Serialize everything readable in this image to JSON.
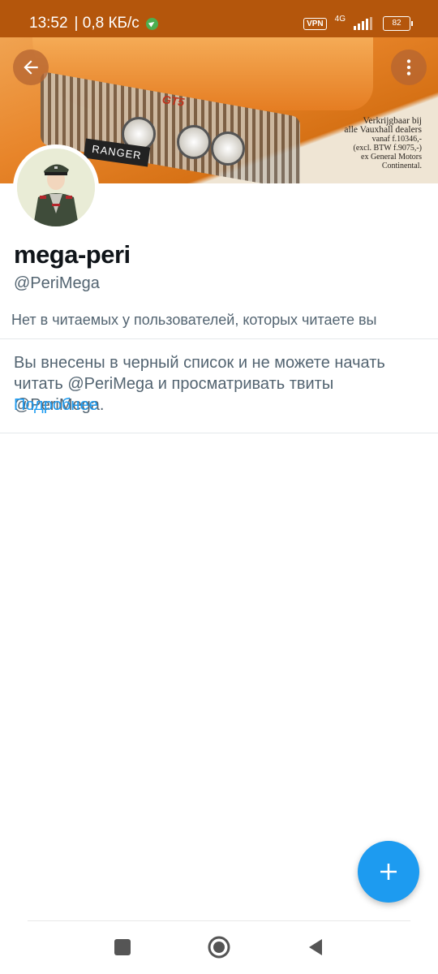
{
  "status_bar": {
    "time": "13:52",
    "speed": "| 0,8 КБ/с",
    "vpn": "VPN",
    "network": "4G",
    "battery": "82",
    "bg_color": "#b4560c"
  },
  "banner": {
    "plate_text": "RANGER",
    "model_badge": "GT5",
    "ad_lines": [
      "Verkrijgbaar bij",
      "alle Vauxhall dealers",
      "vanaf f.10346,-",
      "(excl. BTW f.9075,-)",
      "ex General Motors",
      "Continental."
    ]
  },
  "profile": {
    "display_name": "mega-peri",
    "handle": "@PeriMega",
    "follow_info": "Нет в читаемых у пользователей, которых читаете вы"
  },
  "blocked": {
    "message": "Вы внесены в черный список и не можете начать читать @PeriMega и просматривать твиты @PeriMega.",
    "link_label": "Подробнее"
  },
  "colors": {
    "accent": "#1d9bf0",
    "secondary_text": "#536471"
  },
  "icons": {
    "back": "arrow-left",
    "more": "vertical-ellipsis",
    "compose": "plus",
    "nav_recent": "square",
    "nav_home": "circle",
    "nav_back": "triangle"
  }
}
